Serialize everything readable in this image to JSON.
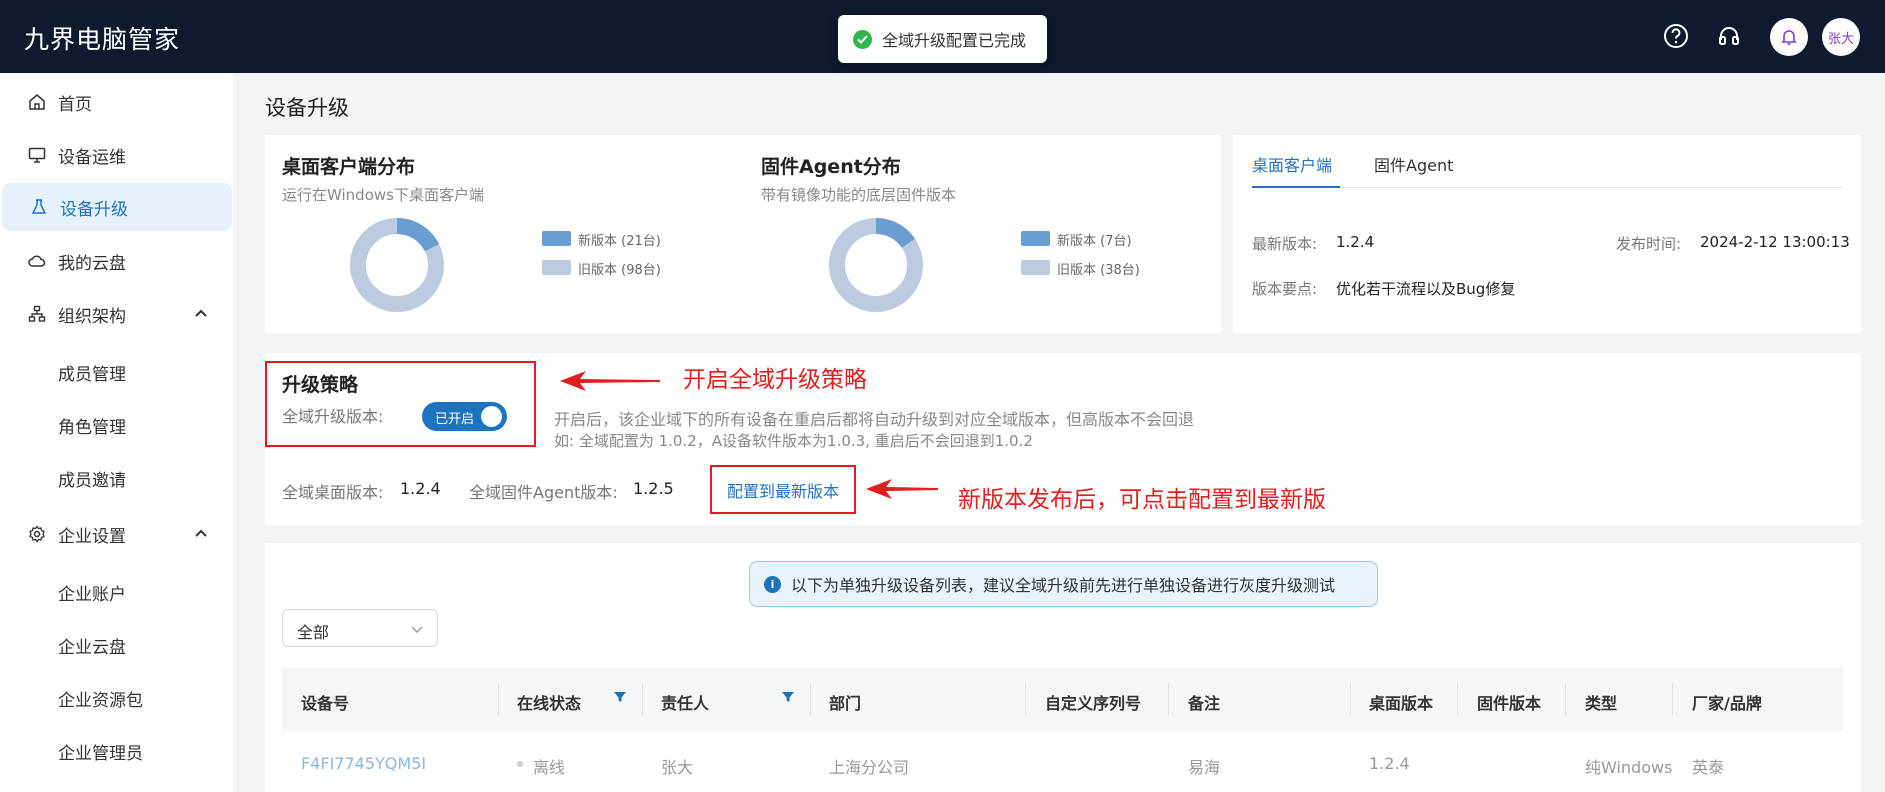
{
  "app": {
    "title": "九界电脑管家"
  },
  "toast": {
    "message": "全域升级配置已完成"
  },
  "header": {
    "user_name": "张大",
    "icons": [
      "help-icon",
      "headset-icon",
      "bell-icon"
    ]
  },
  "sidebar": {
    "items": [
      {
        "label": "首页",
        "icon": "home-icon"
      },
      {
        "label": "设备运维",
        "icon": "monitor-icon"
      },
      {
        "label": "设备升级",
        "icon": "flask-icon"
      },
      {
        "label": "我的云盘",
        "icon": "cloud-icon"
      },
      {
        "label": "组织架构",
        "icon": "org-icon"
      },
      {
        "label": "企业设置",
        "icon": "gear-icon"
      }
    ],
    "org_sub": [
      "成员管理",
      "角色管理",
      "成员邀请"
    ],
    "enterprise_sub": [
      "企业账户",
      "企业云盘",
      "企业资源包",
      "企业管理员"
    ]
  },
  "page": {
    "title": "设备升级"
  },
  "desktop_dist": {
    "title": "桌面客户端分布",
    "subtitle": "运行在Windows下桌面客户端",
    "new_label": "新版本 (21台)",
    "old_label": "旧版本 (98台)",
    "new_count": 21,
    "old_count": 98
  },
  "firmware_dist": {
    "title": "固件Agent分布",
    "subtitle": "带有镜像功能的底层固件版本",
    "new_label": "新版本 (7台)",
    "old_label": "旧版本 (38台)",
    "new_count": 7,
    "old_count": 38
  },
  "release_card": {
    "tabs": [
      "桌面客户端",
      "固件Agent"
    ],
    "latest_label": "最新版本:",
    "latest_value": "1.2.4",
    "date_label": "发布时间:",
    "date_value": "2024-2-12 13:00:13",
    "notes_label": "版本要点:",
    "notes_value": "优化若干流程以及Bug修复"
  },
  "policy": {
    "title": "升级策略",
    "toggle_label": "全域升级版本:",
    "toggle_state": "已开启",
    "desc1": "开启后，该企业域下的所有设备在重启后都将自动升级到对应全域版本，但高版本不会回退",
    "desc2": "如: 全域配置为 1.0.2，A设备软件版本为1.0.3, 重启后不会回退到1.0.2",
    "desktop_ver_label": "全域桌面版本:",
    "desktop_ver_value": "1.2.4",
    "firmware_ver_label": "全域固件Agent版本:",
    "firmware_ver_value": "1.2.5",
    "config_button": "配置到最新版本"
  },
  "annotations": {
    "a1": "开启全域升级策略",
    "a2": "新版本发布后，可点击配置到最新版"
  },
  "device_list": {
    "notice": "以下为单独升级设备列表，建议全域升级前先进行单独设备进行灰度升级测试",
    "filter_value": "全部",
    "columns": [
      "设备号",
      "在线状态",
      "责任人",
      "部门",
      "自定义序列号",
      "备注",
      "桌面版本",
      "固件版本",
      "类型",
      "厂家/品牌"
    ],
    "rows": [
      {
        "device_id": "F4FI7745YQM5I",
        "status": "离线",
        "owner": "张大",
        "dept": "上海分公司",
        "serial": "",
        "note": "易海",
        "desktop_ver": "1.2.4",
        "firmware_ver": "",
        "type": "纯Windows",
        "brand": "英泰"
      }
    ]
  },
  "colors": {
    "accent": "#1e73be",
    "topbar": "#0f1a2e",
    "annotation": "#e02020",
    "donut_new": "#6a9ed2",
    "donut_old": "#bccbe0"
  }
}
